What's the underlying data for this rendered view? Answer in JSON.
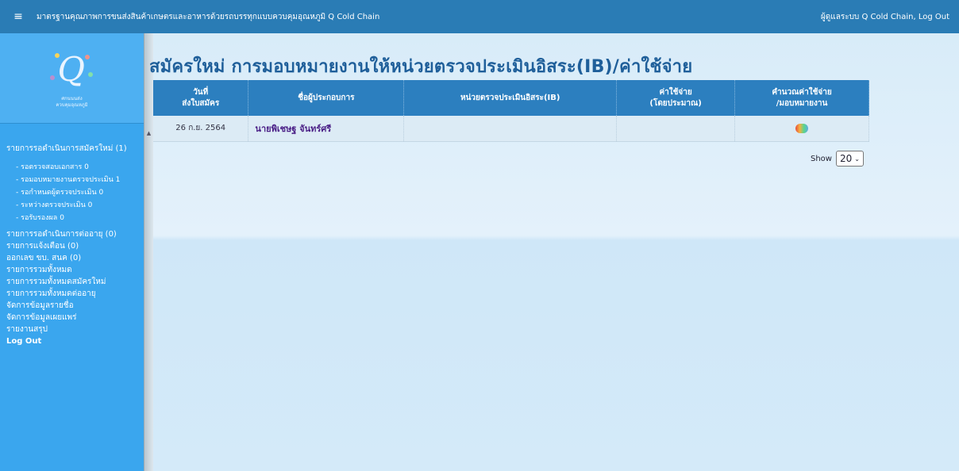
{
  "topbar": {
    "menu_icon": "hamburger-icon",
    "title": "มาตรฐานคุณภาพการขนส่งสินค้าเกษตรและอาหารด้วยรถบรรทุกแบบควบคุมอุณหภูมิ Q Cold Chain",
    "user": "ผู้ดูแลระบบ Q Cold Chain, Log Out"
  },
  "sidebar": {
    "logo_sub_1": "ศกนนนส่ง",
    "logo_sub_2": "ควบคุมอุณหภูมิ",
    "new_apps_label": "รายการรอดำเนินการสมัครใหม่",
    "new_apps_count": "(1)",
    "sub_items": [
      {
        "label": "- รอตรวจสอบเอกสาร",
        "count": "0"
      },
      {
        "label": "- รอมอบหมายงานตรวจประเมิน",
        "count": "1"
      },
      {
        "label": "- รอกำหนดผู้ตรวจประเมิน",
        "count": "0"
      },
      {
        "label": "- ระหว่างตรวจประเมิน",
        "count": "0"
      },
      {
        "label": "- รอรับรองผล",
        "count": "0"
      }
    ],
    "renew_label": "รายการรอดำเนินการต่ออายุ",
    "renew_count": "(0)",
    "notify_label": "รายการแจ้งเตือน",
    "notify_count": "(0)",
    "issue_label": "ออกเลข ขบ. สนค",
    "issue_count": "(0)",
    "items": [
      "รายการรวมทั้งหมด",
      "รายการรวมทั้งหมดสมัครใหม่",
      "รายการรวมทั้งหมดต่ออายุ",
      "จัดการข้อมูลรายชื่อ",
      "จัดการข้อมูลเผยแพร่",
      "รายงานสรุป",
      "Log Out"
    ]
  },
  "main": {
    "page_title": "สมัครใหม่ การมอบหมายงานให้หน่วยตรวจประเมินอิสระ(IB)/ค่าใช้จ่าย",
    "columns": [
      [
        "วันที่",
        "ส่งใบสมัคร"
      ],
      [
        "ชื่อผู้ประกอบการ",
        ""
      ],
      [
        "หน่วยตรวจประเมินอิสระ(IB)",
        ""
      ],
      [
        "ค่าใช้จ่าย",
        "(โดยประมาณ)"
      ],
      [
        "คำนวณค่าใช้จ่าย",
        "/มอบหมายงาน"
      ]
    ],
    "rows": [
      {
        "date": "26 ก.ย. 2564",
        "name": "นายพิเชษฐ จันทร์ศรี",
        "ib": "",
        "cost": "",
        "icon": "calculator-icon"
      }
    ],
    "show_label": "Show",
    "show_value": "20"
  }
}
